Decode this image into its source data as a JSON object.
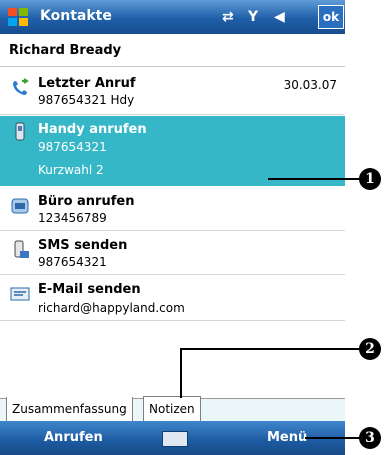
{
  "titlebar": {
    "title": "Kontakte",
    "ok_label": "ok"
  },
  "contact": {
    "name": "Richard Bready"
  },
  "items": [
    {
      "label": "Letzter Anruf",
      "sub": "987654321 Hdy",
      "date": "30.03.07"
    },
    {
      "label": "Handy anrufen",
      "sub": "987654321",
      "extra": "Kurzwahl 2"
    },
    {
      "label": "Büro anrufen",
      "sub": "123456789"
    },
    {
      "label": "SMS senden",
      "sub": "987654321"
    },
    {
      "label": "E-Mail senden",
      "sub": "richard@happyland.com"
    }
  ],
  "tabs": [
    "Zusammenfassung",
    "Notizen"
  ],
  "softkeys": {
    "left": "Anrufen",
    "right": "Menü"
  },
  "callouts": [
    "1",
    "2",
    "3"
  ],
  "colors": {
    "selection": "#36b7c7",
    "bar": "#1f5fa8"
  }
}
